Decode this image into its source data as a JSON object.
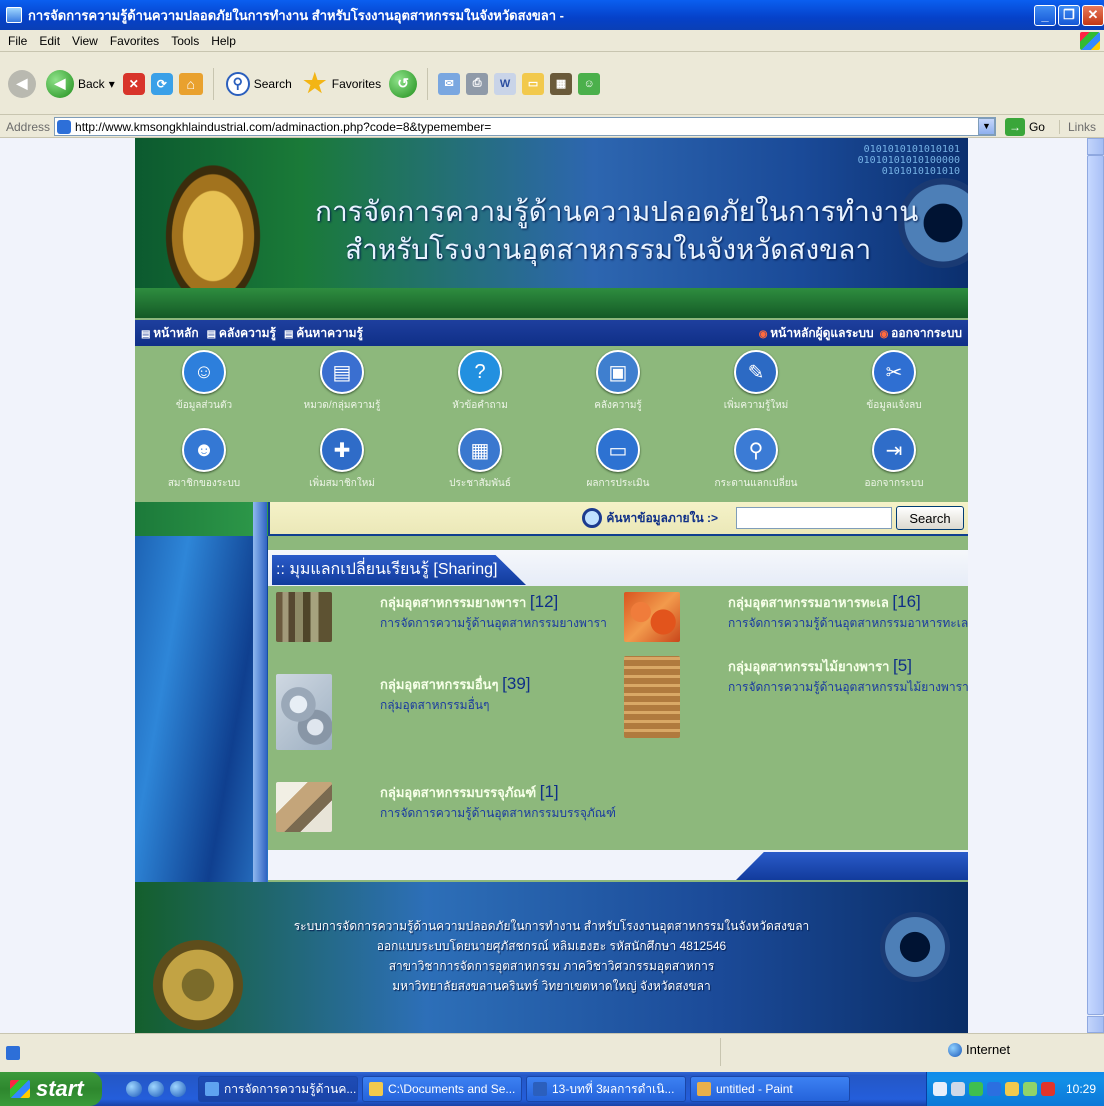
{
  "window": {
    "title": "การจัดการความรู้ด้านความปลอดภัยในการทำงาน สำหรับโรงงานอุตสาหกรรมในจังหวัดสงขลา -",
    "minimize": "_",
    "maximize": "❐",
    "close": "✕"
  },
  "menu": [
    "File",
    "Edit",
    "View",
    "Favorites",
    "Tools",
    "Help"
  ],
  "toolbar": {
    "back": "Back",
    "search": "Search",
    "favorites": "Favorites"
  },
  "address": {
    "label": "Address",
    "url": "http://www.kmsongkhlaindustrial.com/adminaction.php?code=8&typemember=",
    "go": "Go",
    "links": "Links"
  },
  "banner": {
    "line1": "การจัดการความรู้ด้านความปลอดภัยในการทำงาน",
    "line2": "สำหรับโรงงานอุตสาหกรรมในจังหวัดสงขลา",
    "binary1": "0101010101010101",
    "binary2": "01010101010100000",
    "binary3": "0101010101010"
  },
  "nav": {
    "left": [
      "หน้าหลัก",
      "คลังความรู้",
      "ค้นหาความรู้"
    ],
    "right": [
      "หน้าหลักผู้ดูแลระบบ",
      "ออกจากระบบ"
    ]
  },
  "iconmenu": [
    {
      "label": "ข้อมูลส่วนตัว",
      "icon": "person-icon",
      "color": "#2d7fdc"
    },
    {
      "label": "หมวด/กลุ่มความรู้",
      "icon": "folder-icon",
      "color": "#3a6fd0"
    },
    {
      "label": "หัวข้อคำถาม",
      "icon": "question-icon",
      "color": "#2290e0"
    },
    {
      "label": "คลังความรู้",
      "icon": "archive-icon",
      "color": "#3f7fcf"
    },
    {
      "label": "เพิ่มความรู้ใหม่",
      "icon": "edit-icon",
      "color": "#2c6ac4"
    },
    {
      "label": "ข้อมูลแจ้งลบ",
      "icon": "broom-icon",
      "color": "#2f6fd2"
    },
    {
      "label": "สมาชิกของระบบ",
      "icon": "group-icon",
      "color": "#3478d4"
    },
    {
      "label": "เพิ่มสมาชิกใหม่",
      "icon": "add-user-icon",
      "color": "#2f6cc8"
    },
    {
      "label": "ประชาสัมพันธ์",
      "icon": "picture-icon",
      "color": "#3a78cf"
    },
    {
      "label": "ผลการประเมิน",
      "icon": "window-icon",
      "color": "#2d72d2"
    },
    {
      "label": "กระดานแลกเปลี่ยน",
      "icon": "magnifier-icon",
      "color": "#3b7bd5"
    },
    {
      "label": "ออกจากระบบ",
      "icon": "logout-icon",
      "color": "#2f6dc9"
    }
  ],
  "search": {
    "label": "ค้นหาข้อมูลภายใน :>",
    "value": "",
    "button": "Search"
  },
  "section": {
    "title": ":: มุมแลกเปลี่ยนเรียนรู้ [Sharing]"
  },
  "categories": [
    {
      "title": "กลุ่มอุตสาหกรรมยางพารา",
      "count": "[12]",
      "desc": "การจัดการความรู้ด้านอุตสาหกรรมยางพารา",
      "thumb": "rubber-trees-thumb"
    },
    {
      "title": "กลุ่มอุตสาหกรรมอาหารทะเล",
      "count": "[16]",
      "desc": "การจัดการความรู้ด้านอุตสาหกรรมอาหารทะเล",
      "thumb": "seafood-thumb"
    },
    {
      "title": "กลุ่มอุตสาหกรรมอื่นๆ",
      "count": "[39]",
      "desc": "กลุ่มอุตสาหกรรมอื่นๆ",
      "thumb": "gears-thumb"
    },
    {
      "title": "กลุ่มอุตสาหกรรมไม้ยางพารา",
      "count": "[5]",
      "desc": "การจัดการความรู้ด้านอุตสาหกรรมไม้ยางพารา",
      "thumb": "lumber-thumb"
    },
    {
      "title": "กลุ่มอุตสาหกรรมบรรจุภัณฑ์",
      "count": "[1]",
      "desc": "การจัดการความรู้ด้านอุตสาหกรรมบรรจุภัณฑ์",
      "thumb": "packaging-thumb"
    }
  ],
  "footer": [
    "ระบบการจัดการความรู้ด้านความปลอดภัยในการทำงาน สำหรับโรงงานอุตสาหกรรมในจังหวัดสงขลา",
    "ออกแบบระบบโดยนายศุภัสชกรณ์ หลิมเฮงฮะ รหัสนักศึกษา 4812546",
    "สาขาวิชาการจัดการอุตสาหกรรม ภาควิชาวิศวกรรมอุตสาหการ",
    "มหาวิทยาลัยสงขลานครินทร์ วิทยาเขตหาดใหญ่ จังหวัดสงขลา"
  ],
  "status": {
    "zone": "Internet"
  },
  "taskbar": {
    "start": "start",
    "tasks": [
      {
        "label": "การจัดการความรู้ด้านค...",
        "color": "#5fa3f0"
      },
      {
        "label": "C:\\Documents and Se...",
        "color": "#f2c94c"
      },
      {
        "label": "13-บทที่ 3ผลการดำเนิ...",
        "color": "#2b5fbd"
      },
      {
        "label": "untitled - Paint",
        "color": "#e8b04a"
      }
    ],
    "clock": "10:29"
  }
}
